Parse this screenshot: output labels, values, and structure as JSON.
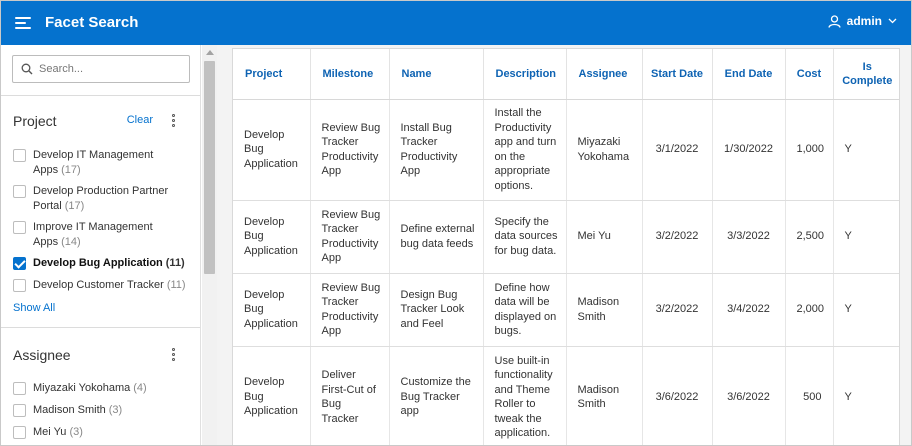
{
  "header": {
    "app_title": "Facet Search",
    "user_name": "admin"
  },
  "search": {
    "placeholder": "Search..."
  },
  "facets": {
    "project": {
      "title": "Project",
      "clear_label": "Clear",
      "options": [
        {
          "line1": "Develop IT Management",
          "line2": "Apps",
          "count": "(17)",
          "checked": false
        },
        {
          "line1": "Develop Production Partner",
          "line2": "Portal",
          "count": "(17)",
          "checked": false
        },
        {
          "line1": "Improve IT Management",
          "line2": "Apps",
          "count": "(14)",
          "checked": false
        },
        {
          "line1": "Develop Bug Application",
          "line2": "",
          "count": "(11)",
          "checked": true
        },
        {
          "line1": "Develop Customer Tracker",
          "line2": "",
          "count": "(11)",
          "checked": false
        }
      ],
      "show_all_label": "Show All"
    },
    "assignee": {
      "title": "Assignee",
      "options": [
        {
          "label": "Miyazaki Yokohama",
          "count": "(4)",
          "checked": false
        },
        {
          "label": "Madison Smith",
          "count": "(3)",
          "checked": false
        },
        {
          "label": "Mei Yu",
          "count": "(3)",
          "checked": false
        }
      ]
    }
  },
  "table": {
    "columns": [
      "Project",
      "Milestone",
      "Name",
      "Description",
      "Assignee",
      "Start Date",
      "End Date",
      "Cost",
      "Is Complete"
    ],
    "rows": [
      {
        "project": "Develop Bug Application",
        "milestone": "Review Bug Tracker Productivity App",
        "name": "Install Bug Tracker Productivity App",
        "description": "Install the Productivity app and turn on the appropriate options.",
        "assignee": "Miyazaki Yokohama",
        "start_date": "3/1/2022",
        "end_date": "1/30/2022",
        "cost": "1,000",
        "is_complete": "Y"
      },
      {
        "project": "Develop Bug Application",
        "milestone": "Review Bug Tracker Productivity App",
        "name": "Define external bug data feeds",
        "description": "Specify the data sources for bug data.",
        "assignee": "Mei Yu",
        "start_date": "3/2/2022",
        "end_date": "3/3/2022",
        "cost": "2,500",
        "is_complete": "Y"
      },
      {
        "project": "Develop Bug Application",
        "milestone": "Review Bug Tracker Productivity App",
        "name": "Design Bug Tracker Look and Feel",
        "description": "Define how data will be displayed on bugs.",
        "assignee": "Madison Smith",
        "start_date": "3/2/2022",
        "end_date": "3/4/2022",
        "cost": "2,000",
        "is_complete": "Y"
      },
      {
        "project": "Develop Bug Application",
        "milestone": "Deliver First-Cut of Bug Tracker",
        "name": "Customize the Bug Tracker app",
        "description": "Use built-in functionality and Theme Roller to tweak the application.",
        "assignee": "Madison Smith",
        "start_date": "3/6/2022",
        "end_date": "3/6/2022",
        "cost": "500",
        "is_complete": "Y"
      }
    ]
  },
  "icons": {
    "menu": "hamburger-menu-icon",
    "user": "user-icon",
    "chevron": "chevron-down-icon",
    "search": "search-icon",
    "kebab": "kebab-menu-icon"
  },
  "colors": {
    "header_bg": "#0572ce",
    "link": "#0572ce",
    "column_header": "#0e63b3"
  }
}
